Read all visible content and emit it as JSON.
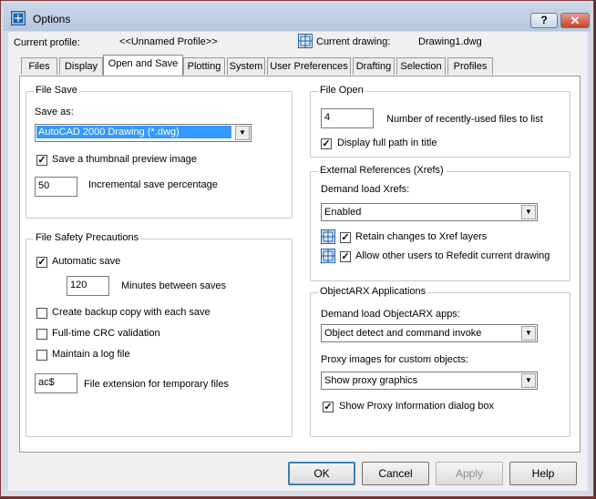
{
  "window": {
    "title": "Options"
  },
  "header": {
    "profile_label": "Current profile:",
    "profile_value": "<<Unnamed Profile>>",
    "drawing_label": "Current drawing:",
    "drawing_value": "Drawing1.dwg"
  },
  "tabs": [
    {
      "label": "Files"
    },
    {
      "label": "Display"
    },
    {
      "label": "Open and Save",
      "active": true
    },
    {
      "label": "Plotting"
    },
    {
      "label": "System"
    },
    {
      "label": "User Preferences"
    },
    {
      "label": "Drafting"
    },
    {
      "label": "Selection"
    },
    {
      "label": "Profiles"
    }
  ],
  "file_save": {
    "title": "File Save",
    "save_as_label": "Save as:",
    "save_as_value": "AutoCAD 2000 Drawing (*.dwg)",
    "thumbnail_label": "Save a thumbnail preview image",
    "thumbnail_checked": true,
    "incremental_value": "50",
    "incremental_label": "Incremental save percentage"
  },
  "safety": {
    "title": "File Safety Precautions",
    "autosave_label": "Automatic save",
    "autosave_checked": true,
    "minutes_value": "120",
    "minutes_label": "Minutes between saves",
    "backup_label": "Create backup copy with each save",
    "crc_label": "Full-time CRC validation",
    "log_label": "Maintain a log file",
    "ext_value": "ac$",
    "ext_label": "File extension for temporary files"
  },
  "file_open": {
    "title": "File Open",
    "recent_value": "4",
    "recent_label": "Number of recently-used files to list",
    "fullpath_label": "Display full path in title",
    "fullpath_checked": true
  },
  "xrefs": {
    "title": "External References (Xrefs)",
    "demand_label": "Demand load Xrefs:",
    "demand_value": "Enabled",
    "retain_label": "Retain changes to Xref layers",
    "retain_checked": true,
    "refedit_label": "Allow other users to Refedit current drawing",
    "refedit_checked": true
  },
  "arx": {
    "title": "ObjectARX Applications",
    "demand_label": "Demand load ObjectARX apps:",
    "demand_value": "Object detect and command invoke",
    "proxy_label": "Proxy images for custom objects:",
    "proxy_value": "Show proxy graphics",
    "info_label": "Show Proxy Information dialog box",
    "info_checked": true
  },
  "buttons": {
    "ok": "OK",
    "cancel": "Cancel",
    "apply": "Apply",
    "help": "Help"
  },
  "titlebar_buttons": {
    "help": "?",
    "close": "✕"
  },
  "icons": {
    "app": "autocad-options-icon",
    "drawing": "drawing-icon"
  }
}
